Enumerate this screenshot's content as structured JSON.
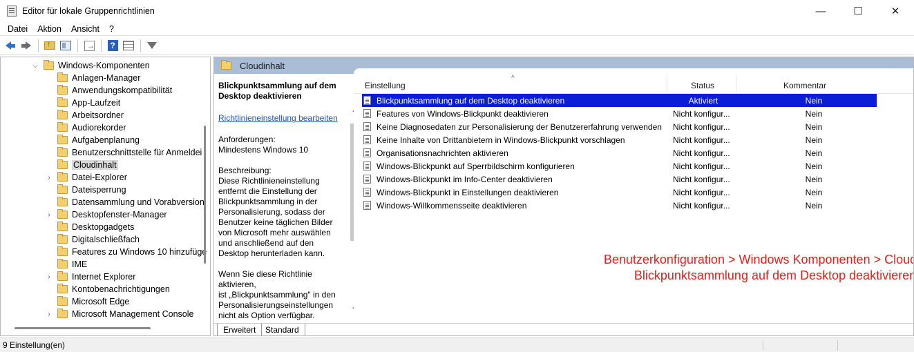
{
  "window": {
    "title": "Editor für lokale Gruppenrichtlinien",
    "minimize": "—",
    "maximize": "☐",
    "close": "✕"
  },
  "menu": [
    "Datei",
    "Aktion",
    "Ansicht",
    "?"
  ],
  "tree": {
    "parent": "Windows-Komponenten",
    "items": [
      {
        "label": "Anlagen-Manager",
        "expandable": false
      },
      {
        "label": "Anwendungskompatibilität",
        "expandable": false
      },
      {
        "label": "App-Laufzeit",
        "expandable": false
      },
      {
        "label": "Arbeitsordner",
        "expandable": false
      },
      {
        "label": "Audiorekorder",
        "expandable": false
      },
      {
        "label": "Aufgabenplanung",
        "expandable": false
      },
      {
        "label": "Benutzerschnittstelle für Anmeldei",
        "expandable": false
      },
      {
        "label": "Cloudinhalt",
        "expandable": false,
        "selected": true
      },
      {
        "label": "Datei-Explorer",
        "expandable": true
      },
      {
        "label": "Dateisperrung",
        "expandable": false
      },
      {
        "label": "Datensammlung und Vorabversion",
        "expandable": false
      },
      {
        "label": "Desktopfenster-Manager",
        "expandable": true
      },
      {
        "label": "Desktopgadgets",
        "expandable": false
      },
      {
        "label": "Digitalschließfach",
        "expandable": false
      },
      {
        "label": "Features zu Windows 10 hinzufüge",
        "expandable": false
      },
      {
        "label": "IME",
        "expandable": false
      },
      {
        "label": "Internet Explorer",
        "expandable": true
      },
      {
        "label": "Kontobenachrichtigungen",
        "expandable": false
      },
      {
        "label": "Microsoft Edge",
        "expandable": false
      },
      {
        "label": "Microsoft Management Console",
        "expandable": true
      }
    ]
  },
  "content": {
    "header": "Cloudinhalt",
    "description": {
      "title": "Blickpunktsammlung auf dem Desktop deaktivieren",
      "edit_link": "Richtlinieneinstellung bearbeiten",
      "requirements": "Anforderungen:\nMindestens Windows 10",
      "body": "Beschreibung:\nDiese Richtlinieneinstellung entfernt die Einstellung der Blickpunktsammlung in der Personalisierung, sodass der Benutzer keine täglichen Bilder von Microsoft mehr auswählen und anschließend auf den Desktop herunterladen kann.\n\nWenn Sie diese Richtlinie aktivieren,\nist „Blickpunktsammlung\" in den Personalisierungseinstellungen nicht als Option verfügbar."
    },
    "columns": {
      "setting": "Einstellung",
      "status": "Status",
      "comment": "Kommentar"
    },
    "rows": [
      {
        "name": "Blickpunktsammlung auf dem Desktop deaktivieren",
        "status": "Aktiviert",
        "comment": "Nein"
      },
      {
        "name": "Features von Windows-Blickpunkt deaktivieren",
        "status": "Nicht konfigur...",
        "comment": "Nein"
      },
      {
        "name": "Keine Diagnosedaten zur Personalisierung der Benutzererfahrung verwenden",
        "status": "Nicht konfigur...",
        "comment": "Nein"
      },
      {
        "name": "Keine Inhalte von Drittanbietern in Windows-Blickpunkt vorschlagen",
        "status": "Nicht konfigur...",
        "comment": "Nein"
      },
      {
        "name": "Organisationsnachrichten aktivieren",
        "status": "Nicht konfigur...",
        "comment": "Nein"
      },
      {
        "name": "Windows-Blickpunkt auf Sperrbildschirm konfigurieren",
        "status": "Nicht konfigur...",
        "comment": "Nein"
      },
      {
        "name": "Windows-Blickpunkt im Info-Center deaktivieren",
        "status": "Nicht konfigur...",
        "comment": "Nein"
      },
      {
        "name": "Windows-Blickpunkt in Einstellungen deaktivieren",
        "status": "Nicht konfigur...",
        "comment": "Nein"
      },
      {
        "name": "Windows-Willkommensseite deaktivieren",
        "status": "Nicht konfigur...",
        "comment": "Nein"
      }
    ],
    "annotation_line1": "Benutzerkonfiguration > Windows Komponenten > Cloudinhalt",
    "annotation_line2": "Blickpunktsammlung auf dem Desktop deaktivieren",
    "tabs": [
      "Erweitert",
      "Standard"
    ]
  },
  "status_bar": {
    "text": "9 Einstellung(en)"
  },
  "colors": {
    "selection": "#0b1ed6",
    "header_band": "#a9bed6",
    "annotation": "#e2231a",
    "link": "#1a57b8"
  }
}
